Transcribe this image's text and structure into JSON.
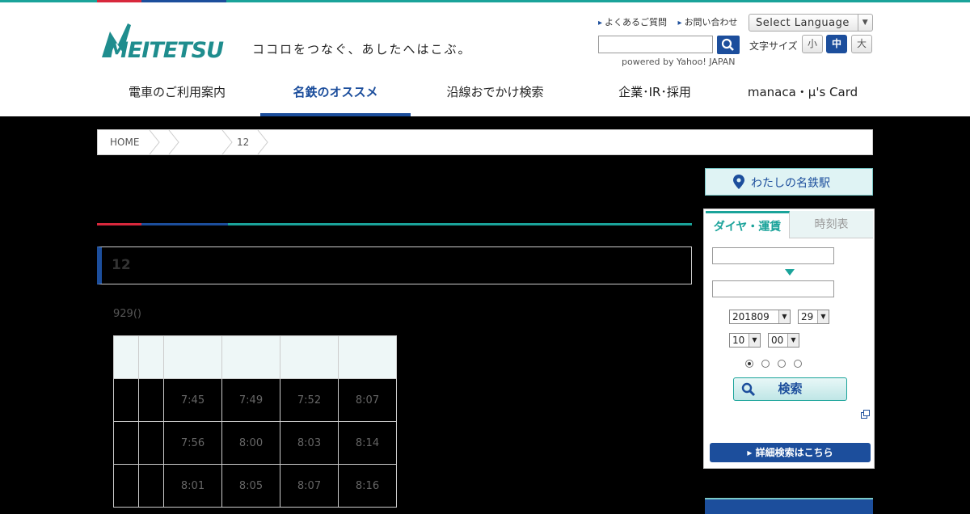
{
  "header": {
    "logo_text": "MEITETSU",
    "tagline": "ココロをつなぐ、あしたへはこぶ。",
    "util_links": [
      "よくあるご質問",
      "お問い合わせ"
    ],
    "language": "Select Language",
    "powered_by": "powered by Yahoo! JAPAN",
    "font_size_label": "文字サイズ",
    "font_sizes": [
      "小",
      "中",
      "大"
    ],
    "font_size_active": "中"
  },
  "nav": {
    "items": [
      "電車のご利用案内",
      "名鉄のオススメ",
      "沿線おでかけ検索",
      "企業･IR･採用",
      "manaca・μ's Card"
    ],
    "active": "名鉄のオススメ"
  },
  "breadcrumb": [
    "HOME",
    "",
    "",
    "12"
  ],
  "main": {
    "page_title": "",
    "section_title": "12",
    "date_note": "929()",
    "table": {
      "rows": [
        [
          "",
          "",
          "7:45",
          "7:49",
          "7:52",
          "8:07"
        ],
        [
          "",
          "",
          "7:56",
          "8:00",
          "8:03",
          "8:14"
        ],
        [
          "",
          "",
          "8:01",
          "8:05",
          "8:07",
          "8:16"
        ]
      ]
    }
  },
  "sidebar": {
    "my_station": "わたしの名鉄駅",
    "tabs": [
      "ダイヤ・運賃",
      "時刻表"
    ],
    "active_tab": "ダイヤ・運賃",
    "year_month": "201809",
    "day": "29",
    "hour": "10",
    "minute": "00",
    "search_label": "検索",
    "detail_link": "詳細検索はこちら"
  },
  "colors": {
    "brand_blue": "#1c4e9c",
    "brand_teal": "#1aa39a",
    "brand_red": "#d8283c"
  }
}
